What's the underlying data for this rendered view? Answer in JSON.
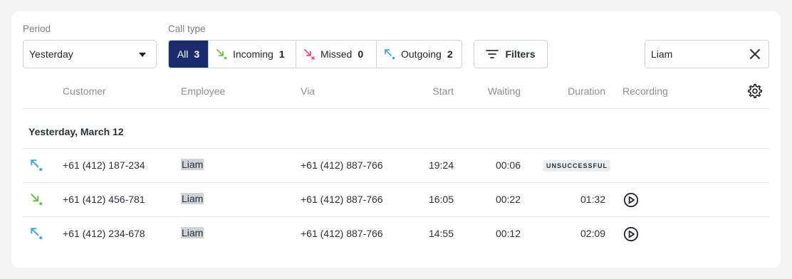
{
  "filters": {
    "period_label": "Period",
    "period_value": "Yesterday",
    "calltype_label": "Call type",
    "call_types": [
      {
        "label": "All",
        "count": "3"
      },
      {
        "label": "Incoming",
        "count": "1"
      },
      {
        "label": "Missed",
        "count": "0"
      },
      {
        "label": "Outgoing",
        "count": "2"
      }
    ],
    "filters_button": "Filters",
    "search_value": "Liam"
  },
  "columns": {
    "customer": "Customer",
    "employee": "Employee",
    "via": "Via",
    "start": "Start",
    "waiting": "Waiting",
    "duration": "Duration",
    "recording": "Recording"
  },
  "group_title": "Yesterday, March 12",
  "rows": [
    {
      "direction": "outgoing",
      "customer": "+61 (412) 187-234",
      "employee": "Liam",
      "via": "+61 (412) 887-766",
      "start": "19:24",
      "waiting": "00:06",
      "duration": "",
      "status": "UNSUCCESSFUL",
      "has_recording": false
    },
    {
      "direction": "incoming",
      "customer": "+61 (412) 456-781",
      "employee": "Liam",
      "via": "+61 (412) 887-766",
      "start": "16:05",
      "waiting": "00:22",
      "duration": "01:32",
      "status": "",
      "has_recording": true
    },
    {
      "direction": "outgoing",
      "customer": "+61 (412) 234-678",
      "employee": "Liam",
      "via": "+61 (412) 887-766",
      "start": "14:55",
      "waiting": "00:12",
      "duration": "02:09",
      "status": "",
      "has_recording": true
    }
  ],
  "colors": {
    "accent": "#1b2c6e",
    "incoming": "#6cc04a",
    "missed": "#e0507a",
    "outgoing": "#4aa3df"
  }
}
